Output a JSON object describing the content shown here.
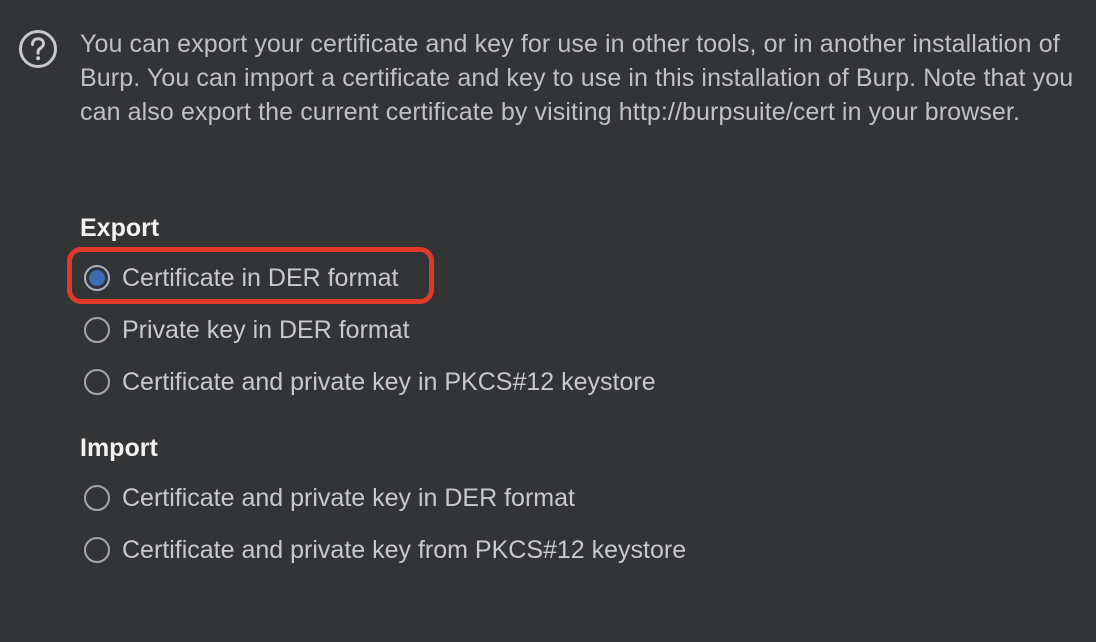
{
  "help": {
    "icon": "question-circle-icon",
    "text": "You can export your certificate and key for use in other tools, or in another installation of Burp. You can import a certificate and key to use in this installation of Burp. Note that you can also export the current certificate by visiting http://burpsuite/cert in your browser."
  },
  "export": {
    "heading": "Export",
    "options": [
      {
        "label": "Certificate in DER format",
        "selected": true
      },
      {
        "label": "Private key in DER format",
        "selected": false
      },
      {
        "label": "Certificate and private key in PKCS#12 keystore",
        "selected": false
      }
    ]
  },
  "import": {
    "heading": "Import",
    "options": [
      {
        "label": "Certificate and private key in DER format",
        "selected": false
      },
      {
        "label": "Certificate and private key from PKCS#12 keystore",
        "selected": false
      }
    ]
  },
  "colors": {
    "background": "#333436",
    "text": "#c7c9cc",
    "heading": "#f2f2f2",
    "radio_selected": "#3d6cb0",
    "annotation_highlight": "#e0392b"
  }
}
